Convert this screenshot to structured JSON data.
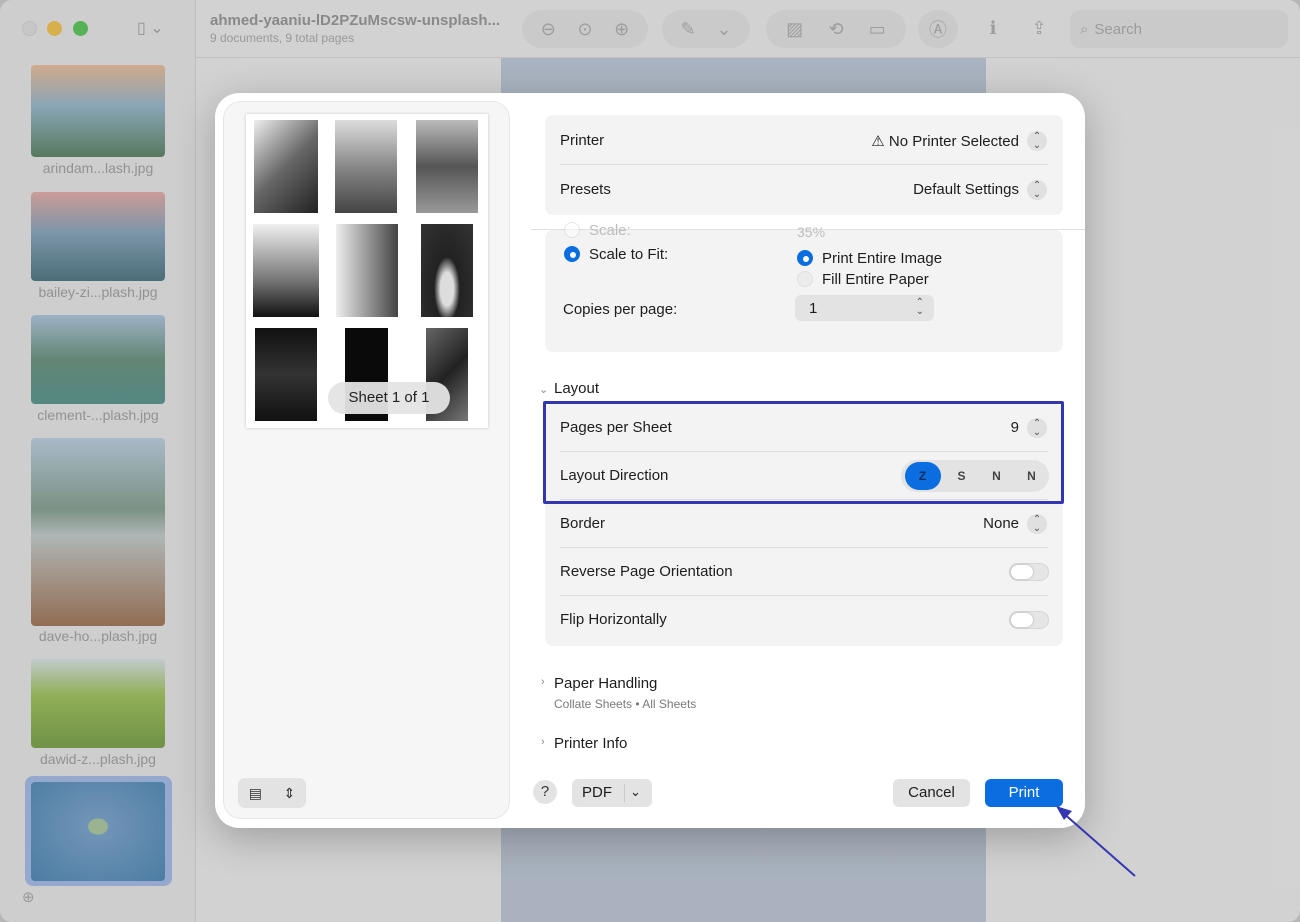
{
  "window": {
    "doc_title": "ahmed-yaaniu-lD2PZuMscsw-unsplash...",
    "doc_subtitle": "9 documents, 9 total pages",
    "search_placeholder": "Search"
  },
  "sidebar": {
    "items": [
      {
        "label": "arindam...lash.jpg",
        "color_top": "#e9b993",
        "color_bottom": "#4f7a58"
      },
      {
        "label": "bailey-zi...plash.jpg",
        "color_top": "#e3a7a0",
        "color_bottom": "#3f6b78"
      },
      {
        "label": "clement-...plash.jpg",
        "color_top": "#a8c3dc",
        "color_bottom": "#4b8d86"
      },
      {
        "label": "dave-ho...plash.jpg",
        "color_top": "#b8cde0",
        "color_bottom": "#9a6a49"
      },
      {
        "label": "dawid-z...plash.jpg",
        "color_top": "#d6e2e6",
        "color_bottom": "#6e9a3a"
      },
      {
        "label": "",
        "color_top": "#6f9cc9",
        "color_bottom": "#3f7fb0"
      }
    ]
  },
  "preview": {
    "sheet_label": "Sheet 1 of 1"
  },
  "dialog": {
    "printer_label": "Printer",
    "printer_value": "No Printer Selected",
    "printer_warning_icon": "⚠",
    "presets_label": "Presets",
    "presets_value": "Default Settings",
    "scale_label": "Scale:",
    "scale_value": "35%",
    "scale_to_fit_label": "Scale to Fit:",
    "print_entire_image": "Print Entire Image",
    "fill_entire_paper": "Fill Entire Paper",
    "copies_per_page_label": "Copies per page:",
    "copies_per_page_value": "1",
    "layout_section": "Layout",
    "pages_per_sheet_label": "Pages per Sheet",
    "pages_per_sheet_value": "9",
    "layout_direction_label": "Layout Direction",
    "layout_direction_options": [
      "Z",
      "S",
      "N",
      "N"
    ],
    "border_label": "Border",
    "border_value": "None",
    "reverse_orientation_label": "Reverse Page Orientation",
    "flip_horizontally_label": "Flip Horizontally",
    "paper_handling_section": "Paper Handling",
    "paper_handling_summary": "Collate Sheets • All Sheets",
    "printer_info_section": "Printer Info",
    "help_label": "?",
    "pdf_label": "PDF",
    "cancel_label": "Cancel",
    "print_label": "Print"
  },
  "colors": {
    "accent": "#0a6de0",
    "highlight_box": "#3336b0",
    "annotation_arrow": "#3336b0"
  }
}
